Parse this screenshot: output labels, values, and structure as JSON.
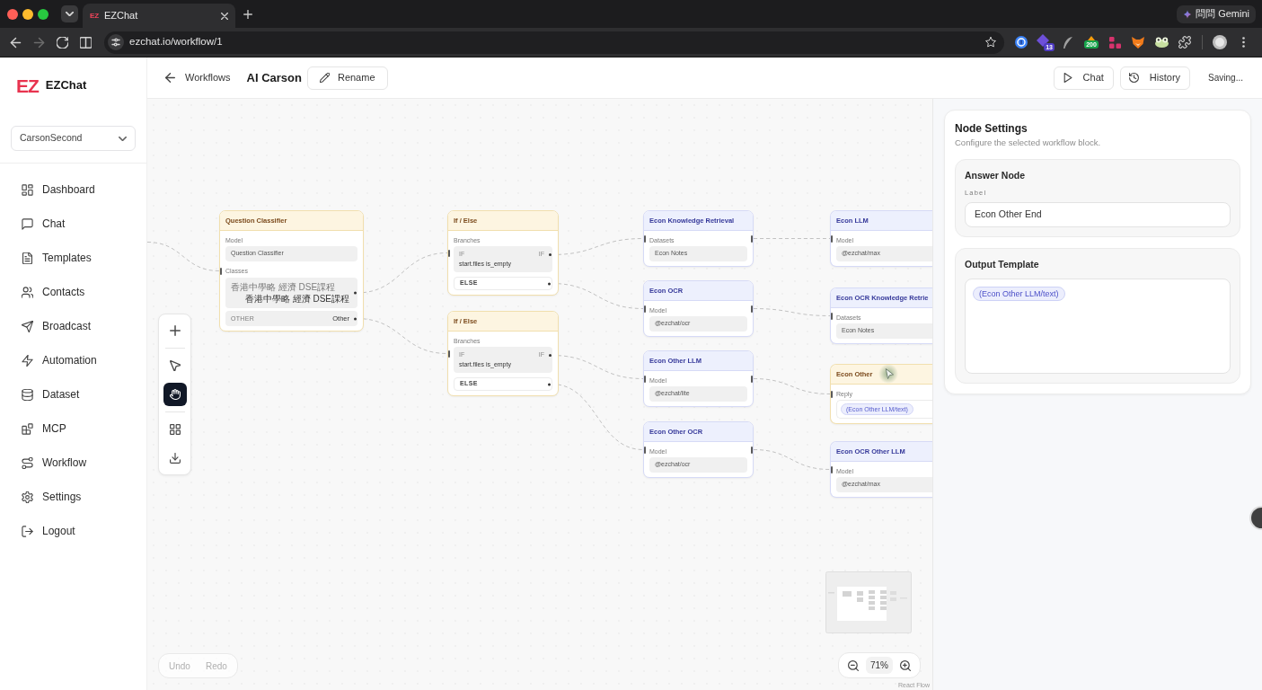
{
  "browser": {
    "tabs": [
      {
        "favicon": "EZ",
        "title": "EZChat",
        "selected": true
      }
    ],
    "url": "ezchat.io/workflow/1",
    "gemini_button": "問問 Gemini",
    "extension_badges": [
      "13",
      "200"
    ]
  },
  "sidebar": {
    "logo": "EZ",
    "brand": "EZChat",
    "workspace": "CarsonSecond",
    "items": [
      {
        "label": "Dashboard"
      },
      {
        "label": "Chat"
      },
      {
        "label": "Templates"
      },
      {
        "label": "Contacts"
      },
      {
        "label": "Broadcast"
      },
      {
        "label": "Automation"
      },
      {
        "label": "Dataset"
      },
      {
        "label": "MCP"
      },
      {
        "label": "Workflow"
      },
      {
        "label": "Settings"
      },
      {
        "label": "Logout"
      }
    ]
  },
  "header": {
    "back_label": "Workflows",
    "title": "AI Carson",
    "rename_button": "Rename",
    "actions": [
      "Chat",
      "History"
    ],
    "status": "Saving..."
  },
  "canvas": {
    "tools": [
      {
        "selected": false
      },
      {
        "selected": false
      },
      {
        "selected": true
      },
      {
        "selected": false
      },
      {
        "selected": false
      }
    ],
    "nodes": [
      {
        "kind": "classifier",
        "title": "Question Classifier",
        "model_label": "Model",
        "model": "Question Classifier",
        "classes_label": "Classes",
        "classes": [
          {
            "key": "香港中學略 經濟 DSE課程",
            "value": "香港中學略 經濟 DSE課程"
          },
          {
            "key": "OTHER",
            "value": "Other"
          }
        ]
      },
      {
        "kind": "if_else",
        "title": "If / Else",
        "branches_label": "Branches",
        "branches": [
          {
            "kind": "if",
            "tag": "IF",
            "port": "IF",
            "condition": "start.files is_empty"
          },
          {
            "kind": "else",
            "tag": "ELSE"
          }
        ]
      },
      {
        "kind": "if_else",
        "title": "If / Else",
        "branches_label": "Branches",
        "branches": [
          {
            "kind": "if",
            "tag": "IF",
            "port": "IF",
            "condition": "start.files is_empty"
          },
          {
            "kind": "else",
            "tag": "ELSE"
          }
        ]
      },
      {
        "kind": "step",
        "title": "Econ Knowledge Retrieval",
        "field_label": "Datasets",
        "value": "Econ Notes"
      },
      {
        "kind": "step",
        "title": "Econ OCR",
        "field_label": "Model",
        "value": "@ezchat/ocr"
      },
      {
        "kind": "step",
        "title": "Econ Other LLM",
        "field_label": "Model",
        "value": "@ezchat/lite"
      },
      {
        "kind": "step",
        "title": "Econ Other OCR",
        "field_label": "Model",
        "value": "@ezchat/ocr"
      },
      {
        "kind": "step",
        "title": "Econ LLM",
        "field_label": "Model",
        "value": "@ezchat/max"
      },
      {
        "kind": "step",
        "title": "Econ OCR Knowledge Retrie",
        "field_label": "Datasets",
        "value": "Econ Notes"
      },
      {
        "kind": "answer",
        "title": "Econ Other",
        "field_label": "Reply",
        "chips": [
          "(Econ Other LLM/text)"
        ]
      },
      {
        "kind": "step",
        "title": "Econ OCR Other LLM",
        "field_label": "Model",
        "value": "@ezchat/max"
      }
    ],
    "history_buttons": [
      {
        "label": "Undo",
        "disabled": true
      },
      {
        "label": "Redo",
        "disabled": true
      }
    ],
    "zoom_label": "71%",
    "attribution": "React Flow"
  },
  "node_settings": {
    "title": "Node Settings",
    "subtitle": "Configure the selected workflow block.",
    "sections": [
      {
        "kind": "field",
        "title": "Answer Node",
        "field_label": "Label",
        "value": "Econ Other End"
      },
      {
        "kind": "template",
        "title": "Output Template",
        "chips": [
          "(Econ Other LLM/text)"
        ]
      }
    ]
  }
}
